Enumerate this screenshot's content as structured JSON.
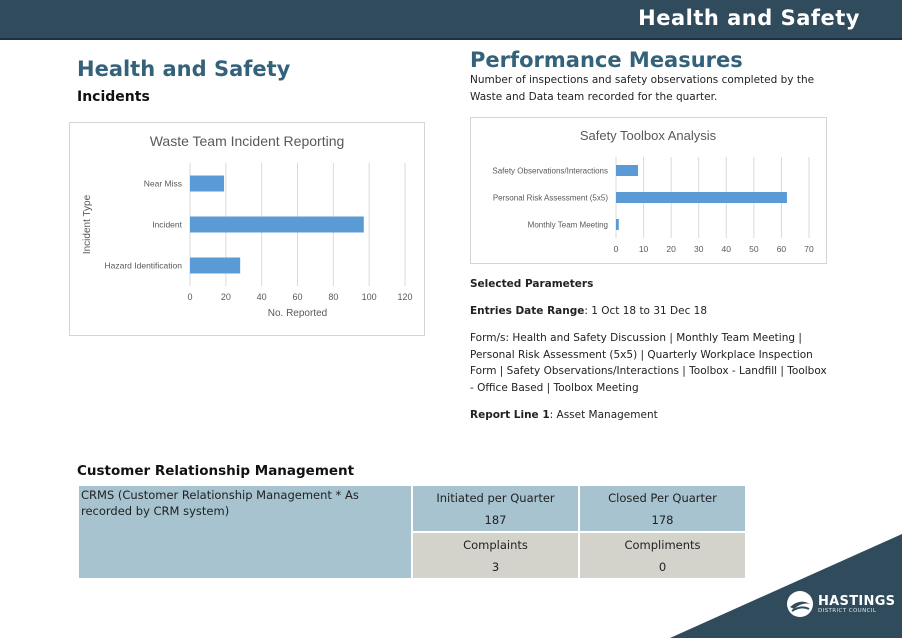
{
  "header": {
    "banner_title": "Health and Safety"
  },
  "left": {
    "title": "Health and Safety",
    "subtitle": "Incidents"
  },
  "right": {
    "title": "Performance Measures",
    "intro": "Number of inspections and safety observations completed by the Waste and Data team recorded for the quarter.",
    "params_heading": "Selected Parameters",
    "entries_label": "Entries Date Range",
    "entries_value": ": 1 Oct 18 to 31 Dec 18",
    "forms_text": "Form/s: Health and Safety Discussion | Monthly Team Meeting | Personal Risk Assessment (5x5) | Quarterly Workplace Inspection Form | Safety Observations/Interactions | Toolbox - Landfill | Toolbox - Office Based | Toolbox Meeting",
    "report_label": "Report Line 1",
    "report_value": ": Asset Management"
  },
  "chart_data": [
    {
      "type": "bar",
      "orientation": "horizontal",
      "title": "Waste Team Incident Reporting",
      "xlabel": "No. Reported",
      "ylabel": "Incident Type",
      "categories": [
        "Near Miss",
        "Incident",
        "Hazard Identification"
      ],
      "values": [
        19,
        97,
        28
      ],
      "xlim": [
        0,
        120
      ],
      "xticks": [
        0,
        20,
        40,
        60,
        80,
        100,
        120
      ],
      "grid": true,
      "color": "#5b9bd5"
    },
    {
      "type": "bar",
      "orientation": "horizontal",
      "title": "Safety Toolbox Analysis",
      "xlabel": "",
      "ylabel": "",
      "categories": [
        "Safety Observations/Interactions",
        "Personal Risk Assessment (5x5)",
        "Monthly Team Meeting"
      ],
      "values": [
        8,
        62,
        1
      ],
      "xlim": [
        0,
        70
      ],
      "xticks": [
        0,
        10,
        20,
        30,
        40,
        50,
        60,
        70
      ],
      "grid": true,
      "color": "#5b9bd5"
    }
  ],
  "crm": {
    "title": "Customer Relationship Management",
    "row_label": "CRMS (Customer Relationship Management * As recorded by CRM system)",
    "initiated_label": "Initiated per Quarter",
    "initiated_value": "187",
    "closed_label": "Closed Per Quarter",
    "closed_value": "178",
    "complaints_label": "Complaints",
    "complaints_value": "3",
    "compliments_label": "Compliments",
    "compliments_value": "0"
  },
  "logo": {
    "name": "HASTINGS",
    "sub": "DISTRICT COUNCIL"
  },
  "colors": {
    "banner": "#2f4b5c",
    "heading": "#34627a",
    "bar": "#5b9bd5",
    "cell_blue": "#a6c3cf",
    "cell_grey": "#d3d3cc"
  }
}
